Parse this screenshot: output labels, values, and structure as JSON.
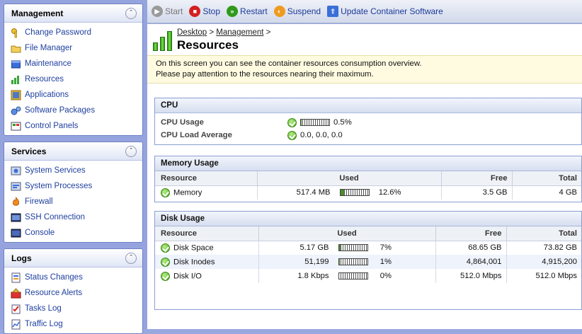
{
  "sidebar": {
    "management": {
      "title": "Management",
      "items": [
        "Change Password",
        "File Manager",
        "Maintenance",
        "Resources",
        "Applications",
        "Software Packages",
        "Control Panels"
      ]
    },
    "services": {
      "title": "Services",
      "items": [
        "System Services",
        "System Processes",
        "Firewall",
        "SSH Connection",
        "Console"
      ]
    },
    "logs": {
      "title": "Logs",
      "items": [
        "Status Changes",
        "Resource Alerts",
        "Tasks Log",
        "Traffic Log"
      ]
    }
  },
  "toolbar": {
    "start": "Start",
    "stop": "Stop",
    "restart": "Restart",
    "suspend": "Suspend",
    "update": "Update Container Software"
  },
  "breadcrumb": {
    "desktop": "Desktop",
    "sep1": " > ",
    "management": "Management",
    "sep2": " >"
  },
  "page_title": "Resources",
  "intro": {
    "line1": "On this screen you can see the container resources consumption overview.",
    "line2": "Please pay attention to the resources nearing their maximum."
  },
  "cpu": {
    "title": "CPU",
    "usage_label": "CPU Usage",
    "usage_value": "0.5%",
    "usage_fraction": 0.005,
    "load_label": "CPU Load Average",
    "load_value": "0.0, 0.0, 0.0"
  },
  "memory": {
    "title": "Memory Usage",
    "headers": {
      "resource": "Resource",
      "used": "Used",
      "free": "Free",
      "total": "Total"
    },
    "rows": [
      {
        "name": "Memory",
        "used": "517.4 MB",
        "percent": "12.6%",
        "fraction": 0.126,
        "free": "3.5 GB",
        "total": "4 GB"
      }
    ]
  },
  "disk": {
    "title": "Disk Usage",
    "headers": {
      "resource": "Resource",
      "used": "Used",
      "free": "Free",
      "total": "Total"
    },
    "rows": [
      {
        "name": "Disk Space",
        "used": "5.17 GB",
        "percent": "7%",
        "fraction": 0.07,
        "free": "68.65 GB",
        "total": "73.82 GB"
      },
      {
        "name": "Disk Inodes",
        "used": "51,199",
        "percent": "1%",
        "fraction": 0.01,
        "free": "4,864,001",
        "total": "4,915,200"
      },
      {
        "name": "Disk I/O",
        "used": "1.8 Kbps",
        "percent": "0%",
        "fraction": 0.0,
        "free": "512.0 Mbps",
        "total": "512.0 Mbps"
      }
    ]
  }
}
